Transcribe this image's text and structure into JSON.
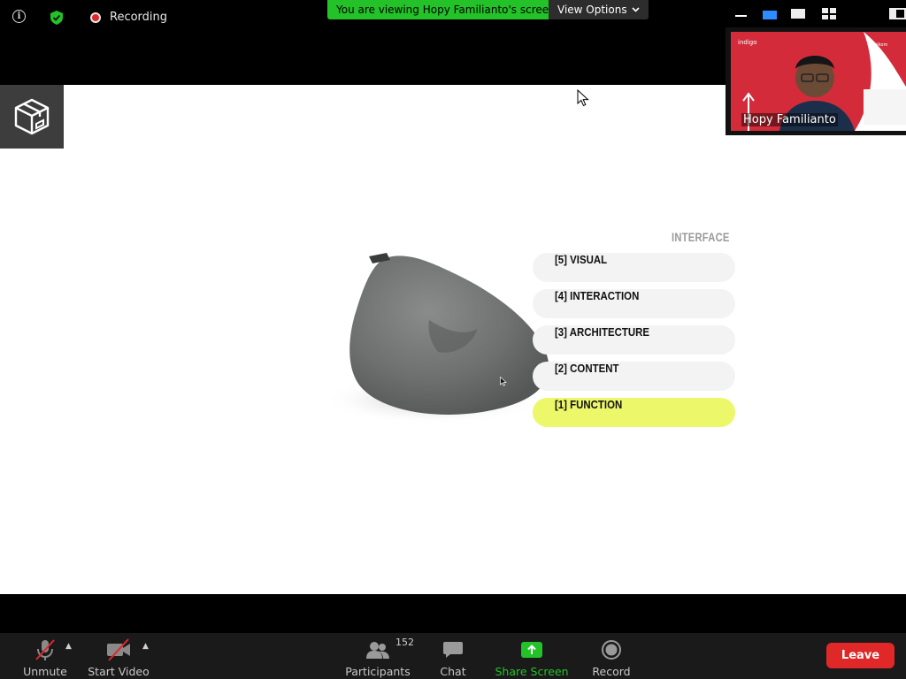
{
  "topbar": {
    "recording_label": "Recording",
    "viewing_banner": "You are viewing Hopy Familianto's screen",
    "view_options_label": "View Options"
  },
  "slide": {
    "heading": "INTERFACE",
    "layers": [
      {
        "label": "[5] VISUAL",
        "active": false
      },
      {
        "label": "[4] INTERACTION",
        "active": false
      },
      {
        "label": "[3] ARCHITECTURE",
        "active": false
      },
      {
        "label": "[2] CONTENT",
        "active": false
      },
      {
        "label": "[1] FUNCTION",
        "active": true
      }
    ],
    "accent_color": "#ecf76a"
  },
  "video": {
    "participant_name": "Hopy Familianto",
    "background_color": "#d42b3a"
  },
  "toolbar": {
    "unmute_label": "Unmute",
    "start_video_label": "Start Video",
    "participants_label": "Participants",
    "participants_count": "152",
    "chat_label": "Chat",
    "share_screen_label": "Share Screen",
    "record_label": "Record",
    "leave_label": "Leave",
    "share_color": "#23c228",
    "leave_color": "#e02828"
  }
}
